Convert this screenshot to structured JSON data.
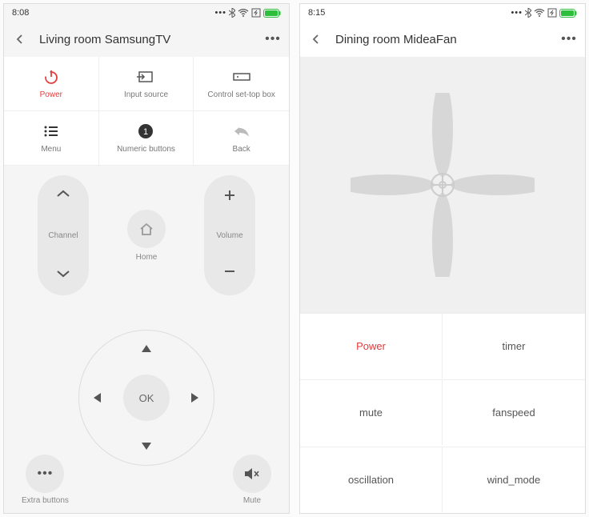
{
  "left": {
    "status_time": "8:08",
    "title": "Living room SamsungTV",
    "grid": {
      "power": "Power",
      "input": "Input source",
      "stb": "Control set-top box",
      "menu": "Menu",
      "numeric": "Numeric buttons",
      "back": "Back"
    },
    "channel": "Channel",
    "home": "Home",
    "volume": "Volume",
    "ok": "OK",
    "extra": "Extra buttons",
    "mute": "Mute"
  },
  "right": {
    "status_time": "8:15",
    "title": "Dining room MideaFan",
    "buttons": {
      "power": "Power",
      "timer": "timer",
      "mute": "mute",
      "fanspeed": "fanspeed",
      "oscillation": "oscillation",
      "wind_mode": "wind_mode"
    }
  }
}
